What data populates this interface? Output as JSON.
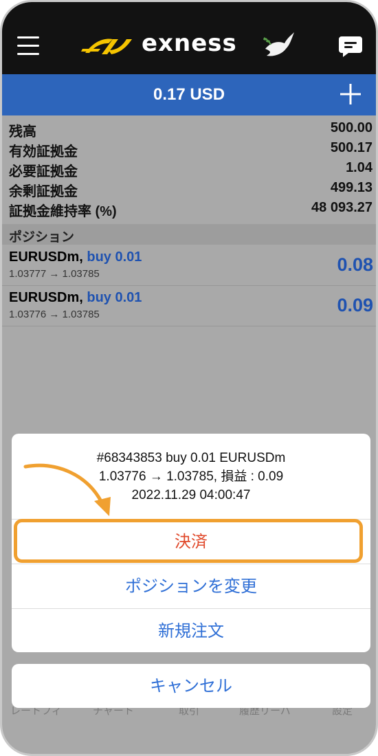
{
  "header": {
    "logo_text": "exness",
    "menu_icon": "hamburger-menu-icon",
    "chat_icon": "chat-bubble-icon"
  },
  "balance_bar": {
    "label": "0.17 USD",
    "add_icon": "plus-icon"
  },
  "account": {
    "rows": [
      {
        "label": "残高",
        "value": "500.00"
      },
      {
        "label": "有効証拠金",
        "value": "500.17"
      },
      {
        "label": "必要証拠金",
        "value": "1.04"
      },
      {
        "label": "余剰証拠金",
        "value": "499.13"
      },
      {
        "label": "証拠金維持率 (%)",
        "value": "48 093.27"
      }
    ]
  },
  "positions": {
    "title": "ポジション",
    "items": [
      {
        "symbol": "EURUSDm,",
        "side": "buy 0.01",
        "prices": "1.03777 → 1.03785",
        "profit": "0.08"
      },
      {
        "symbol": "EURUSDm,",
        "side": "buy 0.01",
        "prices": "1.03776 → 1.03785",
        "profit": "0.09"
      }
    ]
  },
  "bottom_tabs": [
    "レートフィ",
    "チャート",
    "取引",
    "履歴リーバ",
    "設定"
  ],
  "action_sheet": {
    "info_line1": "#68343853 buy 0.01 EURUSDm",
    "info_line2": "1.03776 → 1.03785, 損益 : 0.09",
    "info_line3": "2022.11.29 04:00:47",
    "close_label": "決済",
    "modify_label": "ポジションを変更",
    "new_order_label": "新規注文",
    "cancel_label": "キャンセル"
  },
  "colors": {
    "topbar": "#121212",
    "accent_blue": "#2d65bb",
    "close_red": "#e0492b",
    "highlight_orange": "#f0a030",
    "logo_yellow": "#f5c400"
  }
}
